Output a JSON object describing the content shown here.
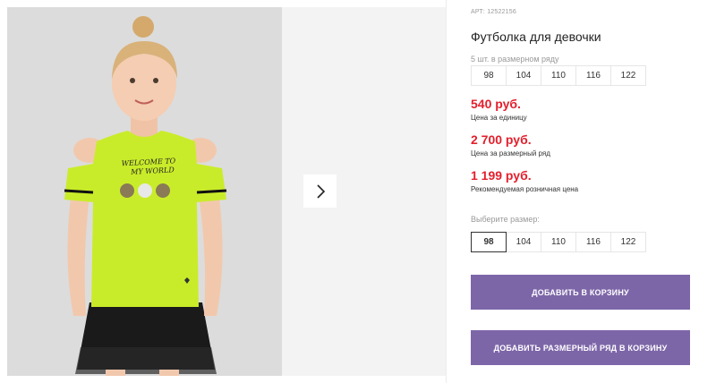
{
  "product": {
    "article": "АРТ: 12522156",
    "title": "Футболка для девочки",
    "pack_note": "5 шт. в размерном ряду",
    "pack_sizes": [
      "98",
      "104",
      "110",
      "116",
      "122"
    ],
    "prices": [
      {
        "value": "540 руб.",
        "label": "Цена за единицу"
      },
      {
        "value": "2 700 руб.",
        "label": "Цена за размерный ряд"
      },
      {
        "value": "1 199 руб.",
        "label": "Рекомендуемая розничная цена"
      }
    ],
    "choose_size_label": "Выберите размер:",
    "size_options": [
      "98",
      "104",
      "110",
      "116",
      "122"
    ],
    "selected_size": "98"
  },
  "buttons": {
    "add_to_cart": "ДОБАВИТЬ В КОРЗИНУ",
    "add_size_row": "ДОБАВИТЬ РАЗМЕРНЫЙ РЯД В КОРЗИНУ"
  },
  "gallery": {
    "next_icon": "chevron-right-icon",
    "shirt_print_line1": "WELCOME TO",
    "shirt_print_line2": "MY WORLD"
  },
  "colors": {
    "price": "#e3202d",
    "button": "#7d66a8",
    "shirt": "#c9ec2a"
  }
}
